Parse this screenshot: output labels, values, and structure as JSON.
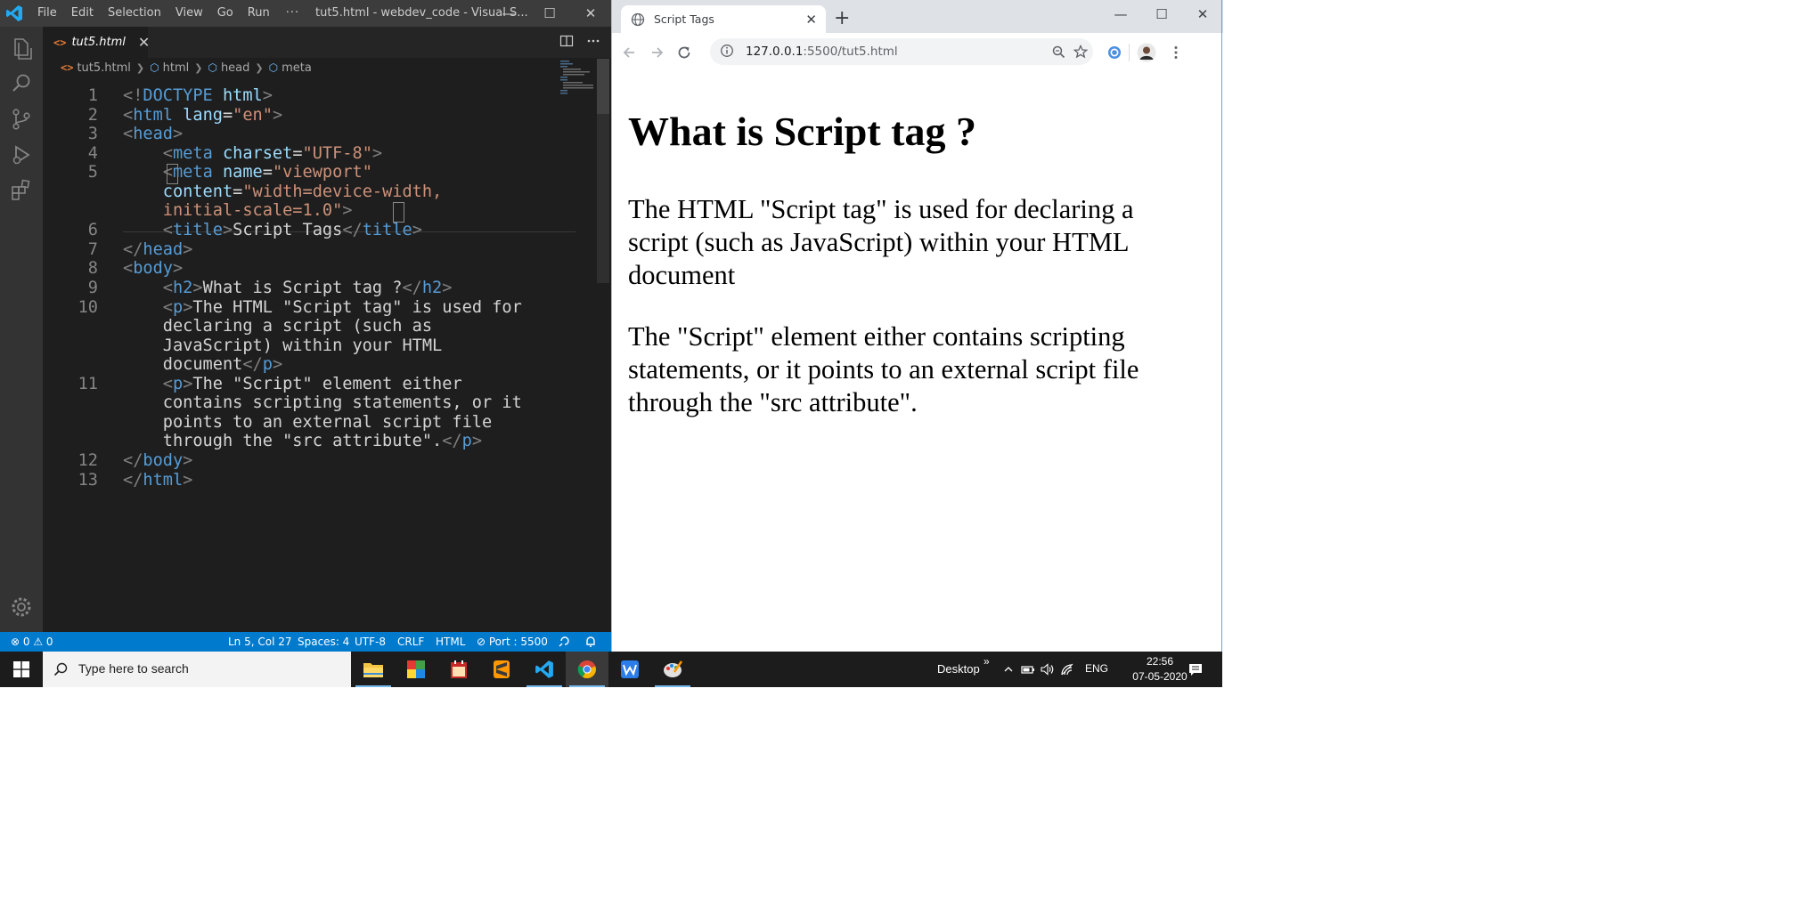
{
  "vscode": {
    "menu": [
      "File",
      "Edit",
      "Selection",
      "View",
      "Go",
      "Run"
    ],
    "menu_more": "···",
    "window_title": "tut5.html - webdev_code - Visual S...",
    "window_controls": {
      "minimize": "—",
      "maximize": "☐",
      "close": "✕"
    },
    "tab": {
      "icon_text": "<>",
      "label": "tut5.html",
      "close": "✕"
    },
    "breadcrumb": {
      "file": "tut5.html",
      "items": [
        "html",
        "head",
        "meta"
      ]
    },
    "line_numbers": [
      "1",
      "2",
      "3",
      "4",
      "5",
      "6",
      "7",
      "8",
      "9",
      "10",
      "11",
      "12",
      "13"
    ],
    "code": {
      "l1_a": "<!",
      "l1_b": "DOCTYPE",
      "l1_c": " html",
      "l1_d": ">",
      "l2_attr": " lang",
      "l2_val": "\"en\"",
      "t_html": "html",
      "t_head": "head",
      "t_meta": "meta",
      "t_title": "title",
      "t_body": "body",
      "t_h2": "h2",
      "t_p": "p",
      "a_charset": " charset",
      "v_charset": "\"UTF-8\"",
      "a_name": " name",
      "v_name": "\"viewport\"",
      "a_content": "content",
      "v_content_1": "\"width=device-width,",
      "v_content_2": "initial-scale=1.0\"",
      "title_text": "Script Tags",
      "h2_text": "What is Script tag ?",
      "p1_1": "The HTML \"Script tag\" is used for",
      "p1_2": "declaring a script (such as",
      "p1_3": "JavaScript) within your HTML",
      "p1_4": "document",
      "p2_1": "The \"Script\" element either",
      "p2_2": "contains scripting statements, or it",
      "p2_3": "points to an external script file",
      "p2_4": "through the \"src attribute\"."
    },
    "status": {
      "errors": "0",
      "warnings": "0",
      "position": "Ln 5, Col 27",
      "spaces": "Spaces: 4",
      "encoding": "UTF-8",
      "eol": "CRLF",
      "language": "HTML",
      "port": "Port : 5500"
    }
  },
  "chrome": {
    "tab_title": "Script Tags",
    "url_host": "127.0.0.1",
    "url_path": ":5500/tut5.html",
    "page": {
      "heading": "What is Script tag ?",
      "p1": "The HTML \"Script tag\" is used for declaring a script (such as JavaScript) within your HTML document",
      "p2": "The \"Script\" element either contains scripting statements, or it points to an external script file through the \"src attribute\"."
    }
  },
  "taskbar": {
    "search_placeholder": "Type here to search",
    "desktop_label": "Desktop",
    "overflow": "»",
    "language": "ENG",
    "time": "22:56",
    "date": "07-05-2020"
  },
  "colors": {
    "vscode_bg": "#1e1e1e",
    "vscode_status": "#007acc",
    "vscode_titlebar": "#3c3c3c",
    "chrome_tabstrip": "#dee1e6",
    "taskbar": "#1c1c1c"
  }
}
